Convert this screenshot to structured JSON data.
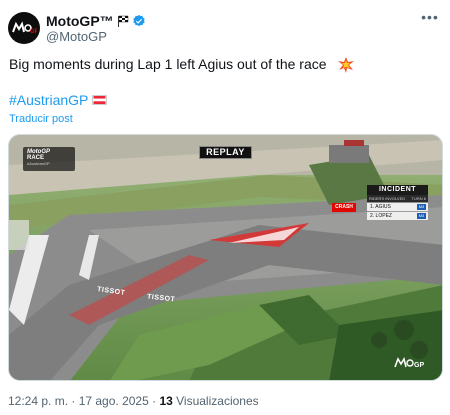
{
  "account": {
    "display_name": "MotoGP™",
    "handle": "@MotoGP",
    "avatar_icon": "motogp-logo-icon",
    "verified_color": "#1d9bf0"
  },
  "tweet": {
    "text": "Big moments during Lap 1 left Agius out of the race",
    "hashtag": "#AustrianGP",
    "translate_label": "Traducir post"
  },
  "video": {
    "replay_label": "REPLAY",
    "race_logo": {
      "line1": "MotoGP",
      "line2": "RACE",
      "line3": "#AustrianGP"
    },
    "incident": {
      "title": "INCIDENT",
      "riders_label": "RIDERS INVOLVED",
      "turn_label": "TURN 6",
      "status": "CRASH",
      "riders": [
        {
          "name": "1. AGIUS",
          "tag": "M3"
        },
        {
          "name": "2. LOPEZ",
          "tag": "M3"
        }
      ]
    },
    "tissot_1": "TISSOT",
    "tissot_2": "TISSOT"
  },
  "meta": {
    "time_date": "12:24 p. m. · 17 ago. 2025 · ",
    "views_count": "13",
    "views_label": " Visualizaciones"
  },
  "colors": {
    "link": "#1d9bf0",
    "muted": "#536471",
    "text": "#0f1419",
    "crash": "#e10600"
  }
}
